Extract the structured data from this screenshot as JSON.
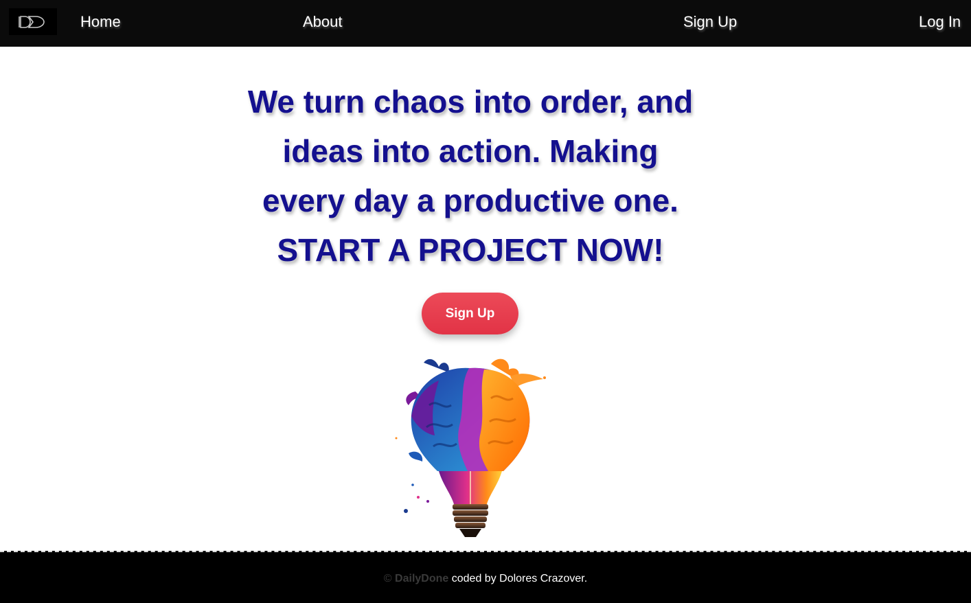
{
  "nav": {
    "home": "Home",
    "about": "About",
    "signup": "Sign Up",
    "login": "Log In",
    "logo_icon": "dd-logo-icon"
  },
  "hero": {
    "lines": [
      "We turn chaos into order, and",
      "ideas into action. Making",
      "every day a productive one.",
      "START A PROJECT NOW!"
    ],
    "cta_label": "Sign Up",
    "illustration": "paint-splash-lightbulb"
  },
  "footer": {
    "copyright_symbol": "©",
    "brand": "DailyDone",
    "credit": "coded by Dolores Crazover."
  },
  "colors": {
    "nav_bg": "#0b0b0b",
    "headline": "#14108f",
    "cta": "#e63b4d",
    "footer_bg": "#000000"
  }
}
